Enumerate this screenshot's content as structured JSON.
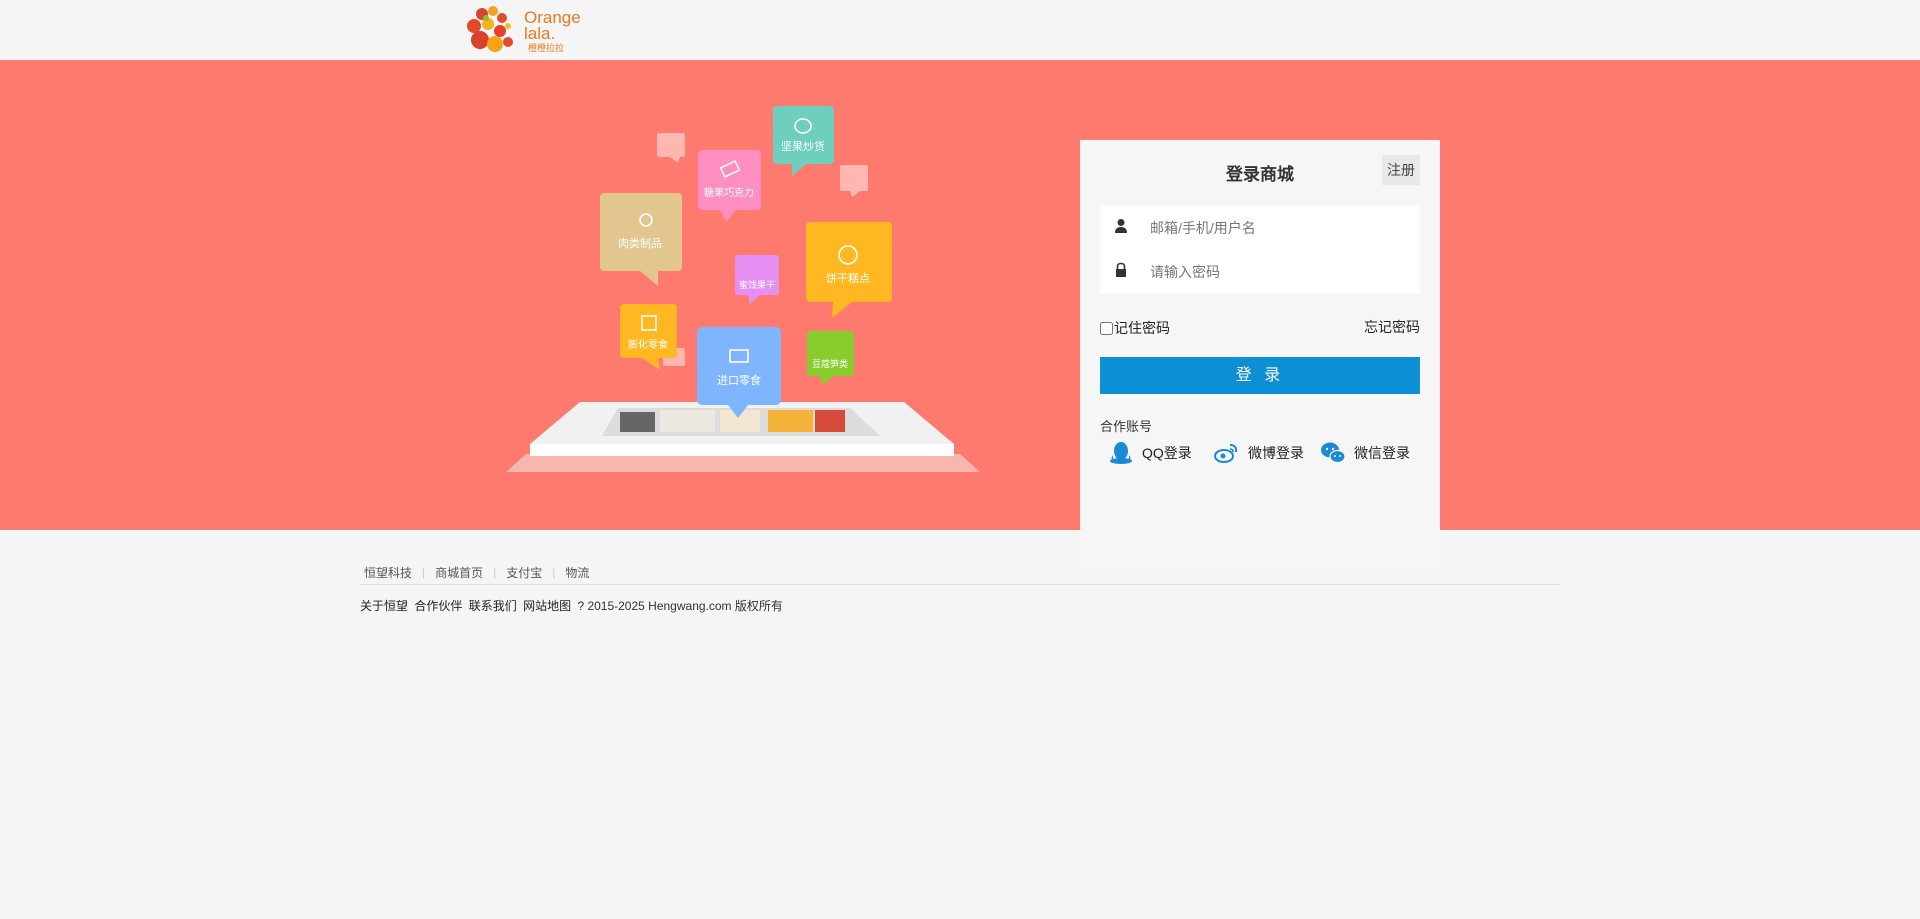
{
  "brand": {
    "name_line1": "Orange",
    "name_line2": "lala.",
    "sub": "橙橙拉拉"
  },
  "illustration": {
    "categories": [
      "坚果炒货",
      "糖果巧克力",
      "肉类制品",
      "蜜饯果干",
      "饼干糕点",
      "膨化零食",
      "进口零食",
      "豆蔻笋类"
    ]
  },
  "login": {
    "title": "登录商城",
    "register": "注册",
    "username_placeholder": "邮箱/手机/用户名",
    "password_placeholder": "请输入密码",
    "remember": "记住密码",
    "forget": "忘记密码",
    "submit": "登 录",
    "partner_label": "合作账号",
    "qq": "QQ登录",
    "weibo": "微博登录",
    "wechat": "微信登录"
  },
  "footer": {
    "links": [
      "恒望科技",
      "商城首页",
      "支付宝",
      "物流"
    ],
    "bottom_links": [
      "关于恒望",
      "合作伙伴",
      "联系我们",
      "网站地图"
    ],
    "copyright": "? 2015-2025 Hengwang.com 版权所有"
  },
  "colors": {
    "banner": "#ff7a6e",
    "primary": "#0d8fd6",
    "brand": "#e87a22"
  }
}
